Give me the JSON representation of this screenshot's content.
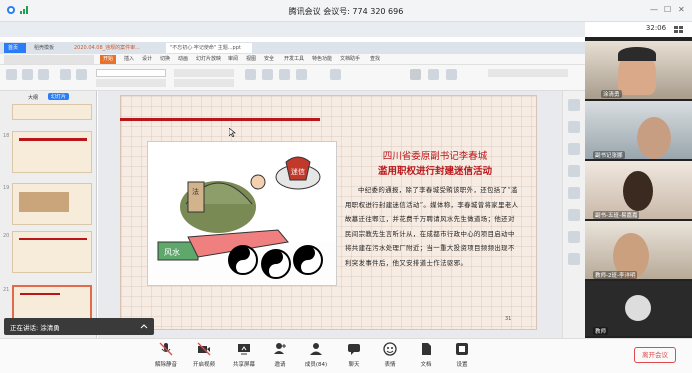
{
  "titlebar": {
    "title": "腾讯会议  会议号: 774 320 696",
    "minimize": "—",
    "maximize": "☐",
    "close": "✕"
  },
  "share": {
    "time": "32:06"
  },
  "tabs": [
    {
      "label": "首页"
    },
    {
      "label": "稻壳模板"
    },
    {
      "label": "2020.04.08_违规的案件审..."
    },
    {
      "label": "\"不忘初心·牢记使命\" 主题...ppt"
    }
  ],
  "ribbon_tabs": [
    "开始",
    "插入",
    "设计",
    "切换",
    "动画",
    "幻灯片放映",
    "审阅",
    "视图",
    "安全",
    "开发工具",
    "特色功能",
    "文档助手",
    "查找"
  ],
  "left_panel": {
    "tab_outline": "大纲",
    "tab_slides": "幻灯片",
    "numbers": [
      "18",
      "19",
      "20",
      "21"
    ]
  },
  "slide": {
    "heading1": "四川省委原副书记李春城",
    "heading2": "滥用职权进行封建迷信活动",
    "para1": "中纪委的通报，除了李春城受贿该职外，还包括了“滥用职权进行封建迷信活动”。媒体称，李春城曾将家里老人故墓迁往郫江，并花费千万聘请风水先生做道场；他还对民间宗教先生言听计从，在成都市行政中心的项目启动中将共建在污水处理厂附近；当一重大投资项目频频出现不利突发事件后，他又安排道士作法驱邪。",
    "page_number": "31",
    "cartoon_words": [
      "迷信",
      "风水",
      "权",
      "老虎"
    ]
  },
  "participants": [
    {
      "name": "涂清勇"
    },
    {
      "name": "副书记张郦"
    },
    {
      "name": "副书记张郦"
    },
    {
      "name": "副书-五班-易嘉嘉"
    },
    {
      "name": "教师-2班-李洋明"
    },
    {
      "name": "教师"
    }
  ],
  "speaking": {
    "label": "正在讲话: 涂清勇"
  },
  "toolbar": {
    "mute": "解除静音",
    "video": "开启视频",
    "share": "共享屏幕",
    "invite": "邀请",
    "members": "成员(84)",
    "chat": "聊天",
    "reaction": "表情",
    "docs": "文档",
    "settings": "设置",
    "leave": "离开会议"
  },
  "colors": {
    "accent": "#b8161a",
    "tencent_blue": "#0a6cff"
  }
}
